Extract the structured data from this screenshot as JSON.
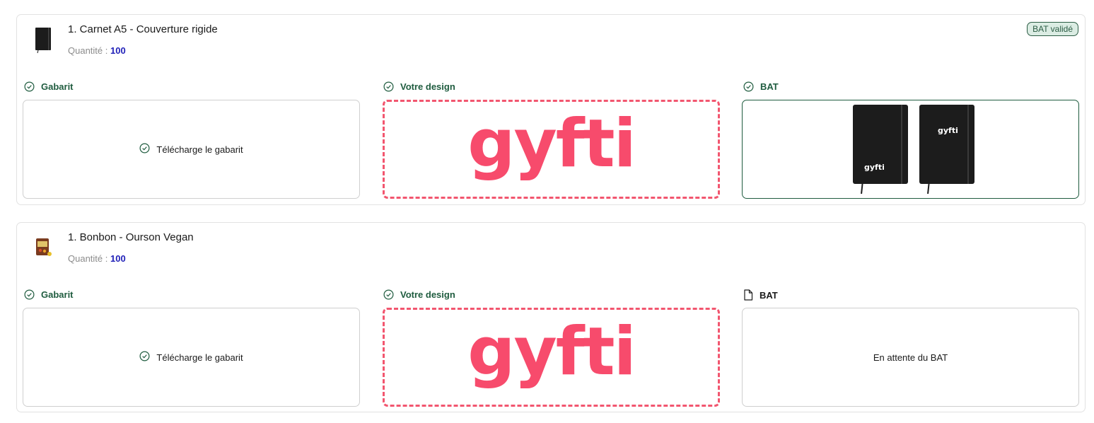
{
  "items": [
    {
      "title": "1. Carnet A5 - Couverture rigide",
      "quantity_label": "Quantité :",
      "quantity_value": "100",
      "badge": "BAT validé",
      "thumbnail_icon": "notebook-thumbnail",
      "columns": {
        "gabarit": {
          "label": "Gabarit",
          "icon": "check-circle-icon",
          "action": "Télécharge le gabarit"
        },
        "design": {
          "label": "Votre design",
          "icon": "check-circle-icon",
          "logo_text": "gyfti"
        },
        "bat": {
          "label": "BAT",
          "icon": "check-circle-icon",
          "mockup_brand": "gyfti"
        }
      }
    },
    {
      "title": "1. Bonbon - Ourson Vegan",
      "quantity_label": "Quantité :",
      "quantity_value": "100",
      "thumbnail_icon": "candy-bag-thumbnail",
      "columns": {
        "gabarit": {
          "label": "Gabarit",
          "icon": "check-circle-icon",
          "action": "Télécharge le gabarit"
        },
        "design": {
          "label": "Votre design",
          "icon": "check-circle-icon",
          "logo_text": "gyfti"
        },
        "bat": {
          "label": "BAT",
          "icon": "file-icon",
          "status": "En attente du BAT"
        }
      }
    }
  ],
  "colors": {
    "accent_green": "#1f5c3f",
    "badge_bg": "#dbece3",
    "quantity_blue": "#1f1fb8",
    "brand_pink": "#f74b6c",
    "dashed_border": "#f2566f"
  }
}
